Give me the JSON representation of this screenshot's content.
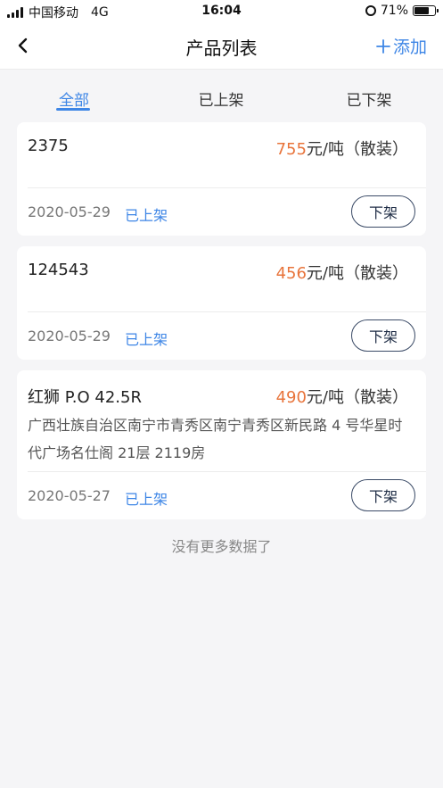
{
  "status_bar": {
    "carrier": "中国移动",
    "network": "4G",
    "time": "16:04",
    "battery_percent": "71%",
    "battery_level": 0.71
  },
  "nav": {
    "title": "产品列表",
    "add_label": "添加"
  },
  "tabs": [
    "全部",
    "已上架",
    "已下架"
  ],
  "active_tab": 0,
  "products": [
    {
      "name": "2375",
      "price": "755",
      "unit": "元/吨（散装）",
      "address": "",
      "date": "2020-05-29",
      "status": "已上架",
      "action": "下架"
    },
    {
      "name": "124543",
      "price": "456",
      "unit": "元/吨（散装）",
      "address": "",
      "date": "2020-05-29",
      "status": "已上架",
      "action": "下架"
    },
    {
      "name": "红狮 P.O 42.5R",
      "price": "490",
      "unit": "元/吨（散装）",
      "address": "广西壮族自治区南宁市青秀区南宁青秀区新民路 4 号华星时代广场名仕阁 21层 2119房",
      "date": "2020-05-27",
      "status": "已上架",
      "action": "下架"
    }
  ],
  "footer_note": "没有更多数据了",
  "colors": {
    "accent": "#3e86e6",
    "price": "#e8743b",
    "background": "#f5f5f7"
  }
}
